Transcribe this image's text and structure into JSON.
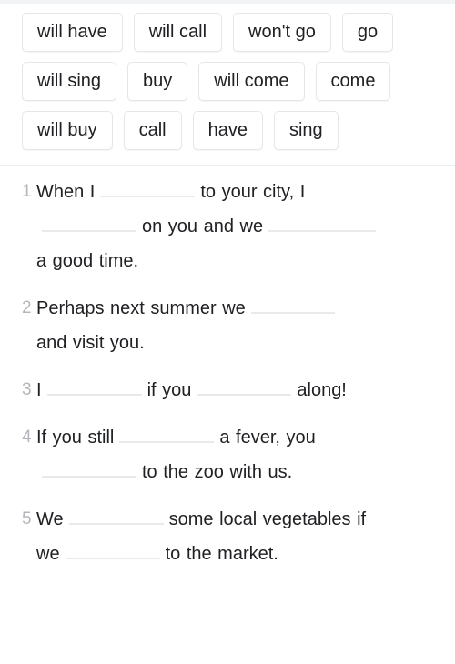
{
  "word_bank": {
    "name": "word-bank",
    "chips": [
      "will have",
      "will call",
      "won't go",
      "go",
      "will sing",
      "buy",
      "will come",
      "come",
      "will buy",
      "call",
      "have",
      "sing"
    ]
  },
  "exercise": {
    "items": [
      {
        "number": "1",
        "segments": [
          {
            "type": "text",
            "value": "When I"
          },
          {
            "type": "blank",
            "size": "lg"
          },
          {
            "type": "text",
            "value": "to your city, I"
          },
          {
            "type": "linebreak"
          },
          {
            "type": "blank",
            "size": "lg"
          },
          {
            "type": "text",
            "value": "on you and we"
          },
          {
            "type": "blank",
            "size": "xl"
          },
          {
            "type": "linebreak"
          },
          {
            "type": "text",
            "value": "a good time."
          }
        ]
      },
      {
        "number": "2",
        "segments": [
          {
            "type": "text",
            "value": "Perhaps next summer we"
          },
          {
            "type": "blank",
            "size": "md"
          },
          {
            "type": "linebreak"
          },
          {
            "type": "text",
            "value": "and visit you."
          }
        ]
      },
      {
        "number": "3",
        "segments": [
          {
            "type": "text",
            "value": "I"
          },
          {
            "type": "blank",
            "size": "lg"
          },
          {
            "type": "text",
            "value": "if you"
          },
          {
            "type": "blank",
            "size": "lg"
          },
          {
            "type": "text",
            "value": "along!"
          }
        ]
      },
      {
        "number": "4",
        "segments": [
          {
            "type": "text",
            "value": "If you still"
          },
          {
            "type": "blank",
            "size": "lg"
          },
          {
            "type": "text",
            "value": "a fever, you"
          },
          {
            "type": "linebreak"
          },
          {
            "type": "blank",
            "size": "lg"
          },
          {
            "type": "text",
            "value": "to the zoo with us."
          }
        ]
      },
      {
        "number": "5",
        "segments": [
          {
            "type": "text",
            "value": "We"
          },
          {
            "type": "blank",
            "size": "lg"
          },
          {
            "type": "text",
            "value": "some local vegetables if"
          },
          {
            "type": "linebreak"
          },
          {
            "type": "text",
            "value": "we"
          },
          {
            "type": "blank",
            "size": "lg"
          },
          {
            "type": "text",
            "value": "to the market."
          }
        ]
      }
    ]
  },
  "colors": {
    "background": "#ffffff",
    "text": "#202124",
    "number": "#b3b7bb",
    "chip_border": "#e4e6e8",
    "blank_line": "#e9eaec",
    "divider": "#eceef0"
  }
}
